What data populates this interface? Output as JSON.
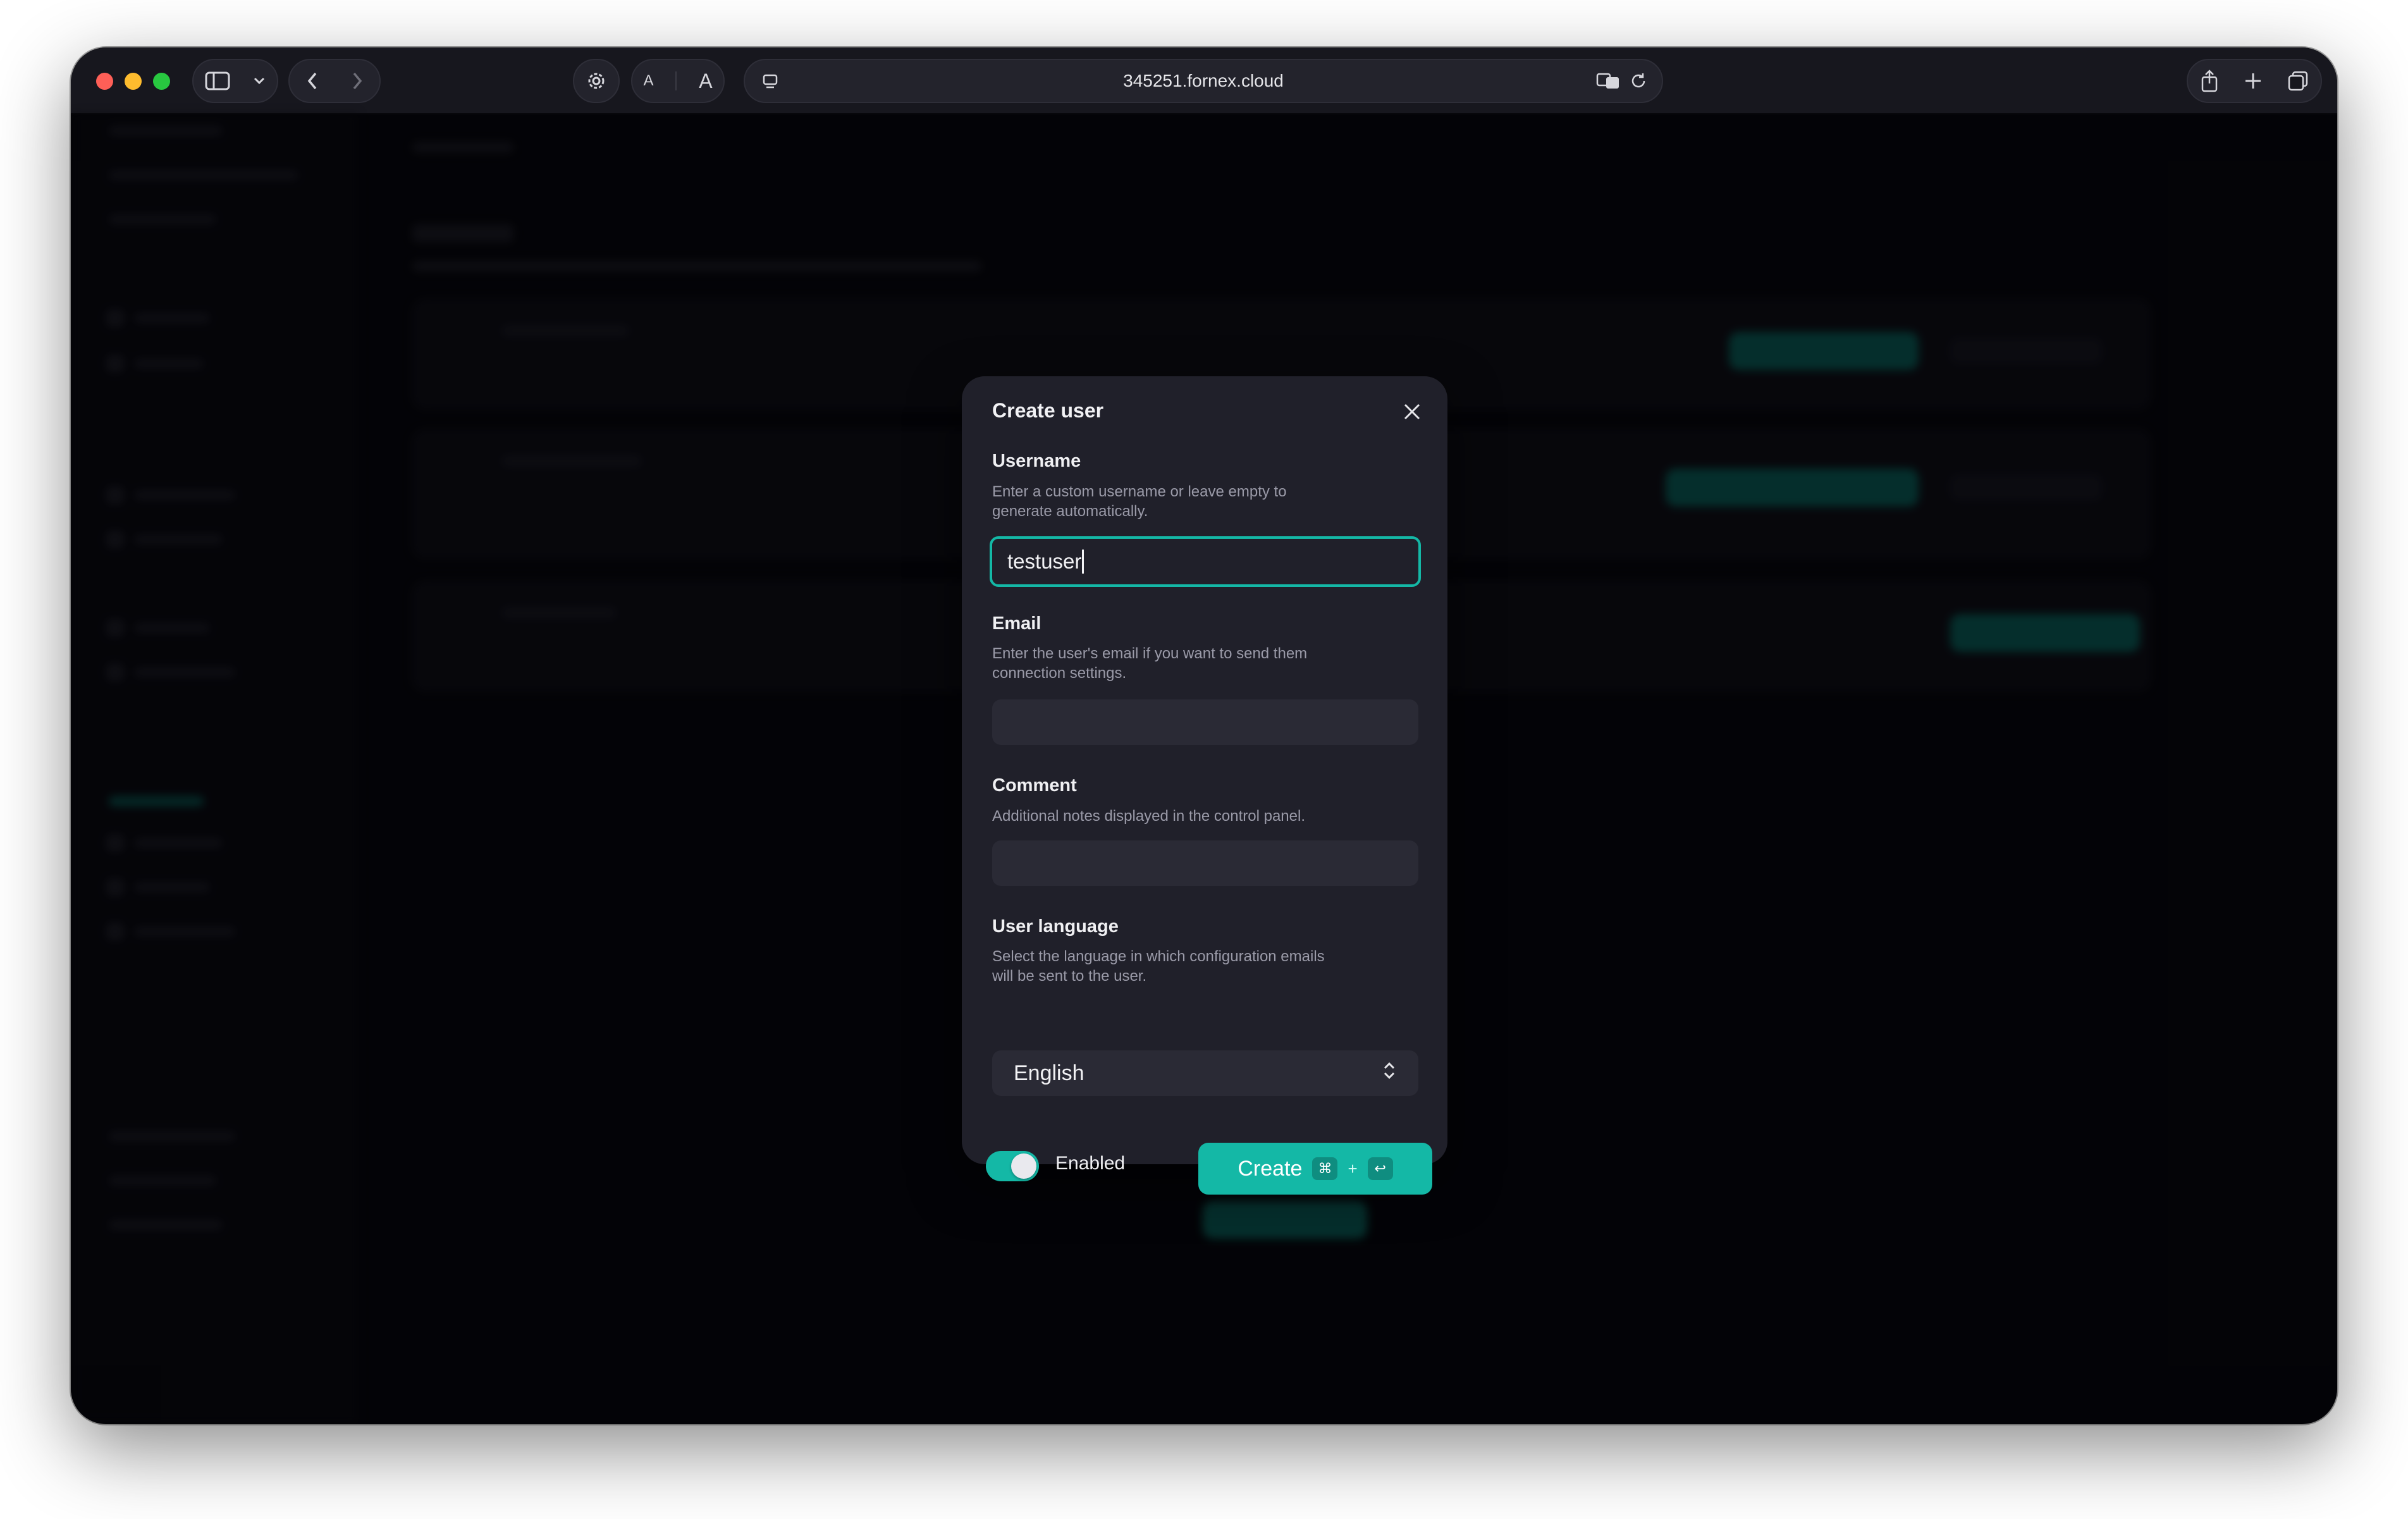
{
  "browser": {
    "url": "345251.fornex.cloud",
    "text_size_small": "A",
    "text_size_large": "A"
  },
  "modal": {
    "title": "Create user",
    "username": {
      "label": "Username",
      "help": "Enter a custom username or leave empty to generate automatically.",
      "value": "testuser"
    },
    "email": {
      "label": "Email",
      "help": "Enter the user's email if you want to send them connection settings.",
      "value": ""
    },
    "comment": {
      "label": "Comment",
      "help": "Additional notes displayed in the control panel.",
      "value": ""
    },
    "language": {
      "label": "User language",
      "help": "Select the language in which configuration emails will be sent to the user.",
      "selected": "English"
    },
    "enabled": {
      "label": "Enabled",
      "on": true
    },
    "create_button": {
      "label": "Create",
      "shortcut_mod": "⌘",
      "shortcut_plus": "+",
      "shortcut_key": "↩"
    }
  },
  "colors": {
    "accent": "#14b8a6",
    "modal_bg": "#20202a",
    "input_bg": "#2a2a35"
  }
}
